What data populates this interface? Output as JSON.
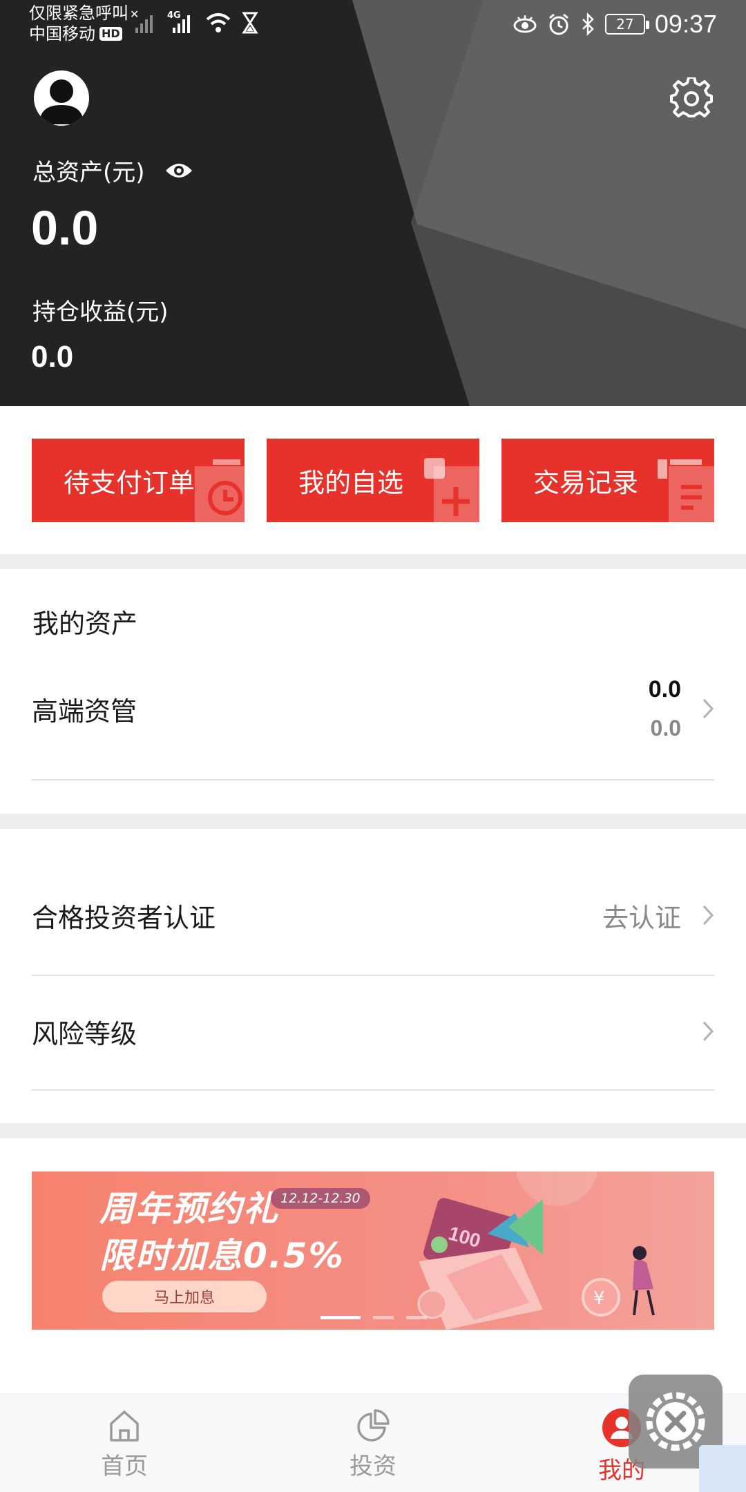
{
  "status": {
    "carrier_line1": "仅限紧急呼叫",
    "carrier_line2": "中国移动",
    "hd": "HD",
    "network": "4G",
    "battery": "27",
    "time": "09:37"
  },
  "header": {
    "total_label": "总资产(元)",
    "total_value": "0.0",
    "hold_label": "持仓收益(元)",
    "hold_value": "0.0"
  },
  "quick_actions": [
    {
      "label": "待支付订单",
      "icon": "clock-icon"
    },
    {
      "label": "我的自选",
      "icon": "plus-icon"
    },
    {
      "label": "交易记录",
      "icon": "list-icon"
    }
  ],
  "assets": {
    "title": "我的资产",
    "item_label": "高端资管",
    "value_main": "0.0",
    "value_sub": "0.0"
  },
  "menu": {
    "qualified_label": "合格投资者认证",
    "qualified_action": "去认证",
    "risk_label": "风险等级"
  },
  "banner": {
    "line1": "周年预约礼",
    "line2": "限时加息0.5%",
    "date": "12.12-12.30",
    "button": "马上加息",
    "card_text": "100",
    "slide_index": 0,
    "slide_count": 3
  },
  "nav": {
    "home": "首页",
    "invest": "投资",
    "mine": "我的",
    "active": "mine"
  },
  "colors": {
    "accent": "#e6322b",
    "header_bg": "#232325"
  }
}
